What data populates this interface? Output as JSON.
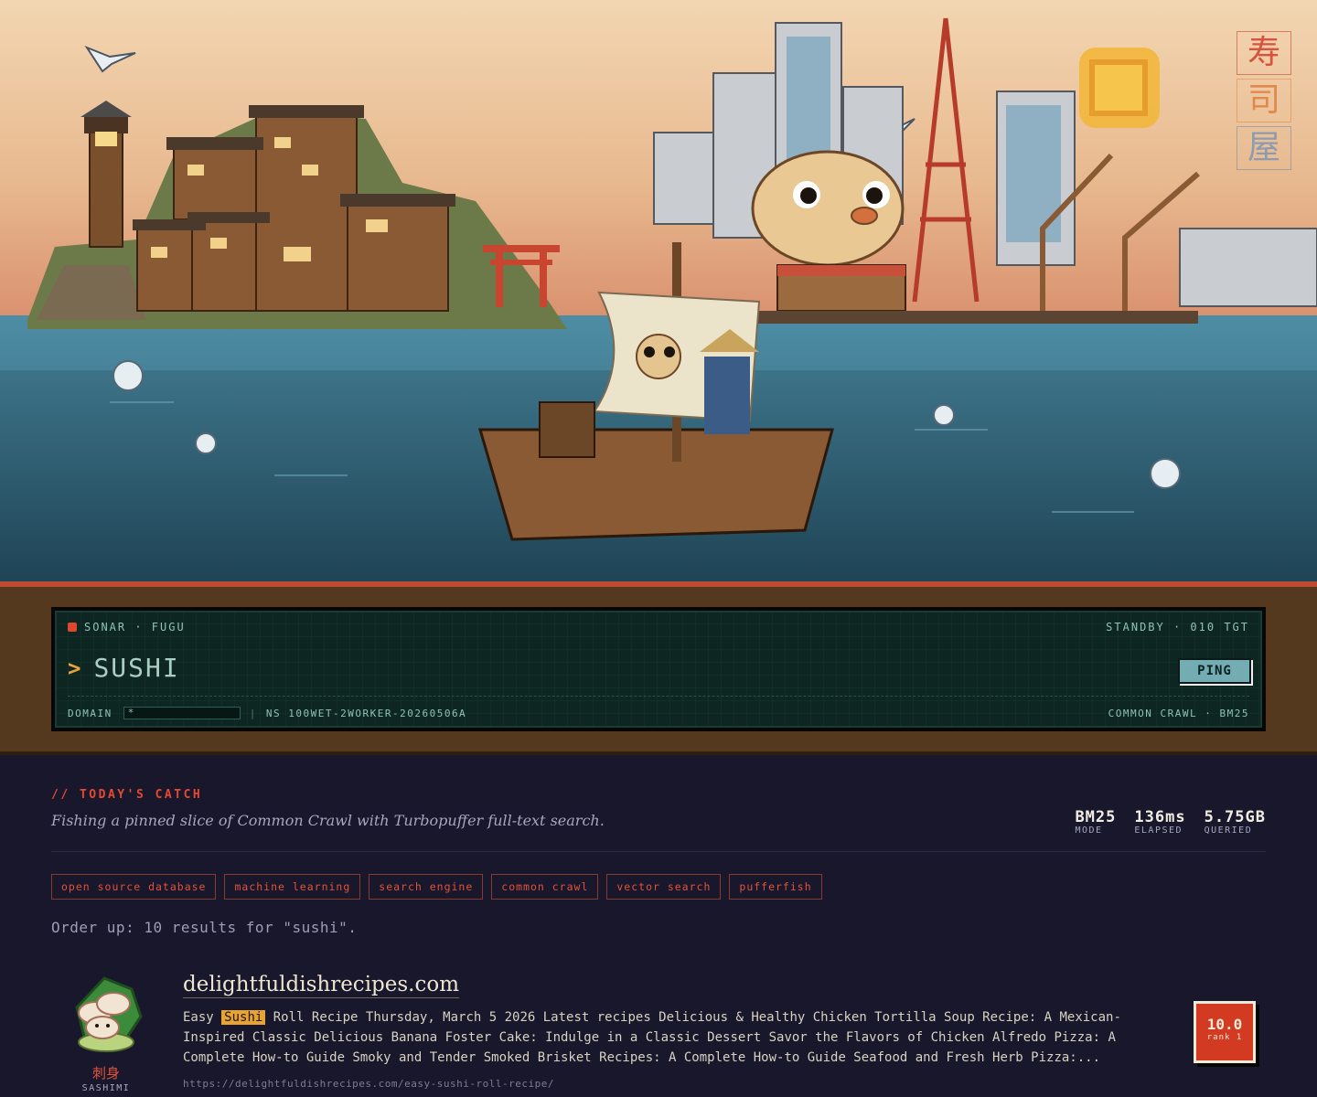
{
  "hero": {
    "kanji": [
      "寿",
      "司",
      "屋"
    ]
  },
  "sonar": {
    "title": "SONAR · FUGU",
    "status": "STANDBY · 010 TGT",
    "query": "SUSHI",
    "ping_label": "PING",
    "domain_label": "DOMAIN",
    "domain_value": "*",
    "ns_label": "NS 100WET-2WORKER-20260506A",
    "source": "COMMON CRAWL · BM25"
  },
  "catch": {
    "label": "// TODAY'S CATCH",
    "subtitle": "Fishing a pinned slice of Common Crawl with Turbopuffer full-text search.",
    "stats": [
      {
        "value": "BM25",
        "label": "MODE"
      },
      {
        "value": "136ms",
        "label": "ELAPSED"
      },
      {
        "value": "5.75GB",
        "label": "QUERIED"
      }
    ],
    "tags": [
      "open source database",
      "machine learning",
      "search engine",
      "common crawl",
      "vector search",
      "pufferfish"
    ],
    "order_up": "Order up: 10 results for \"sushi\"."
  },
  "result": {
    "thumb_jp": "刺身",
    "thumb_en": "SASHIMI",
    "title": "delightfuldishrecipes.com",
    "snippet_before": "Easy ",
    "snippet_highlight": "Sushi",
    "snippet_after": " Roll Recipe Thursday, March 5 2026 Latest recipes Delicious & Healthy Chicken Tortilla Soup Recipe: A Mexican-Inspired Classic Delicious Banana Foster Cake: Indulge in a Classic Dessert Savor the Flavors of Chicken Alfredo Pizza: A Complete How-to Guide Smoky and Tender Smoked Brisket Recipes: A Complete How-to Guide Seafood and Fresh Herb Pizza:...",
    "url": "https://delightfuldishrecipes.com/easy-sushi-roll-recipe/",
    "score": "10.0",
    "rank": "rank 1"
  },
  "colors": {
    "accent_red": "#e44a30",
    "highlight": "#e8a332",
    "sonar_bg": "#0e2621",
    "page_bg": "#18172c"
  }
}
